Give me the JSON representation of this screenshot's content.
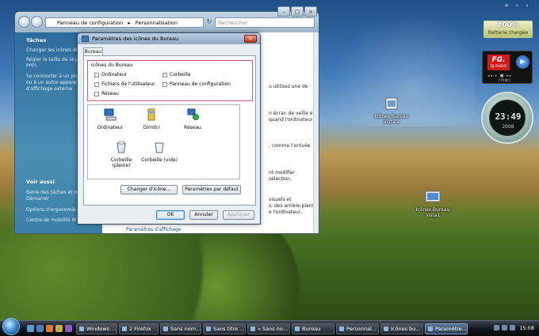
{
  "explorer": {
    "breadcrumb": [
      "Panneau de configuration",
      "Personnalisation"
    ],
    "search_placeholder": "Rechercher",
    "sidebar": {
      "tasks_heading": "Tâches",
      "tasks": [
        "Changer les icônes du",
        "Régler la taille de la po",
        "PPP)",
        "Se connecter à un projec",
        "ou à un autre apparei",
        "d'affichage externe"
      ],
      "see_also_heading": "Voir aussi",
      "see_also": [
        "Barre des tâches et me",
        "Démarrer",
        "Options d'ergonomie",
        "Centre de mobilité Wi"
      ]
    },
    "content_snippets": [
      "u utilisez une de",
      "n écran de veille et",
      "quand l'ordinateur",
      ", comme l'arrivée",
      "nt modifier",
      "sélection.",
      "visuels et",
      "s, des arrière-plans et",
      "e l'ordinateur,",
      "Paramètres d'affichage"
    ]
  },
  "dialog": {
    "title": "Paramètres des icônes du Bureau",
    "tab": "Bureau",
    "group_title": "Icônes du Bureau",
    "checkboxes": [
      {
        "label": "Ordinateur",
        "checked": false
      },
      {
        "label": "Fichiers de l'utilisateur",
        "checked": false
      },
      {
        "label": "Réseau",
        "checked": false
      },
      {
        "label": "Corbeille",
        "checked": false
      },
      {
        "label": "Panneau de configuration",
        "checked": false
      }
    ],
    "icons": [
      {
        "label": "Ordinateur",
        "icon": "computer-icon"
      },
      {
        "label": "Dimitri",
        "icon": "user-folder-icon"
      },
      {
        "label": "Réseau",
        "icon": "network-icon"
      },
      {
        "label": "Corbeille (pleine)",
        "icon": "recycle-bin-full-icon"
      },
      {
        "label": "Corbeille (vide)",
        "icon": "recycle-bin-empty-icon"
      }
    ],
    "change_icon_label": "Changer d'icône...",
    "default_label": "Paramètres par défaut",
    "ok_label": "OK",
    "cancel_label": "Annuler",
    "apply_label": "Appliquer"
  },
  "gadgets": {
    "battery_pct": "100%",
    "battery_label": "Batterie chargée",
    "radio_logo": "FG.",
    "radio_sub": "DJ RADIO",
    "radio_prd": "[ Prdt ]",
    "clock_time": "23:49",
    "clock_year": "2008"
  },
  "desktop_icons": [
    {
      "label": "Icônes Bureau Vista 2"
    },
    {
      "label": "Icônes Bureau Vista1"
    }
  ],
  "taskbar": {
    "tasks": [
      {
        "label": "Windows ...",
        "active": false
      },
      {
        "label": "2 Firefox",
        "active": false
      },
      {
        "label": "Sans nom...",
        "active": false
      },
      {
        "label": "Sans titre ...",
        "active": false
      },
      {
        "label": "« Sans no...",
        "active": false
      },
      {
        "label": "Bureau",
        "active": false
      },
      {
        "label": "Personnal...",
        "active": false
      },
      {
        "label": "Icônes bu...",
        "active": false
      },
      {
        "label": "Paramètre...",
        "active": true
      }
    ],
    "time": "15:08"
  }
}
